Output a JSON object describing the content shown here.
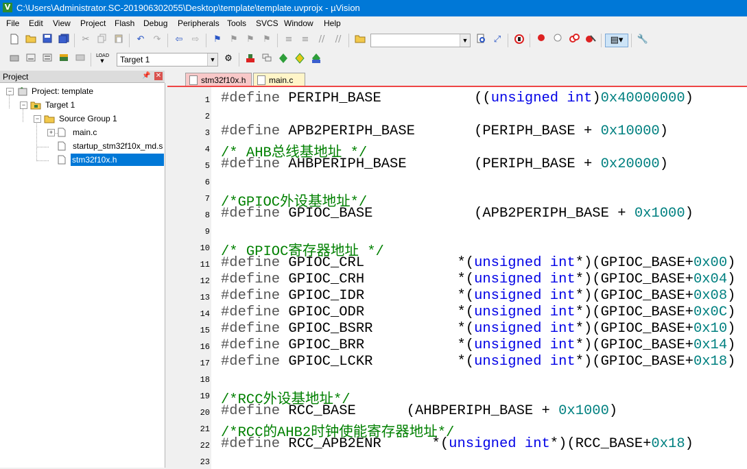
{
  "window": {
    "title": "C:\\Users\\Administrator.SC-201906302055\\Desktop\\template\\template.uvprojx - µVision",
    "app_icon": "V"
  },
  "menu": [
    "File",
    "Edit",
    "View",
    "Project",
    "Flash",
    "Debug",
    "Peripherals",
    "Tools",
    "SVCS",
    "Window",
    "Help"
  ],
  "toolbar2": {
    "target": "Target 1"
  },
  "project_panel": {
    "title": "Project",
    "tree": {
      "project": "Project: template",
      "target": "Target 1",
      "group": "Source Group 1",
      "files": [
        "main.c",
        "startup_stm32f10x_md.s",
        "stm32f10x.h"
      ]
    }
  },
  "tabs": [
    {
      "label": "stm32f10x.h",
      "active": true
    },
    {
      "label": "main.c",
      "active": false
    }
  ],
  "editor": {
    "lines": [
      {
        "n": "1",
        "segs": [
          [
            "kw",
            "#define"
          ],
          [
            "t",
            " PERIPH_BASE           (("
          ],
          [
            "ty",
            "unsigned int"
          ],
          [
            "t",
            ")"
          ],
          [
            "num",
            "0x40000000"
          ],
          [
            "t",
            ")"
          ]
        ]
      },
      {
        "n": "2",
        "segs": []
      },
      {
        "n": "3",
        "segs": [
          [
            "kw",
            "#define"
          ],
          [
            "t",
            " APB2PERIPH_BASE       (PERIPH_BASE + "
          ],
          [
            "num",
            "0x10000"
          ],
          [
            "t",
            ")"
          ]
        ]
      },
      {
        "n": "4",
        "segs": [
          [
            "cm",
            "/* AHB总线基地址 */"
          ]
        ]
      },
      {
        "n": "5",
        "segs": [
          [
            "kw",
            "#define"
          ],
          [
            "t",
            " AHBPERIPH_BASE        (PERIPH_BASE + "
          ],
          [
            "num",
            "0x20000"
          ],
          [
            "t",
            ")"
          ]
        ]
      },
      {
        "n": "6",
        "segs": []
      },
      {
        "n": "7",
        "segs": [
          [
            "cm",
            "/*GPIOC外设基地址*/"
          ]
        ]
      },
      {
        "n": "8",
        "segs": [
          [
            "kw",
            "#define"
          ],
          [
            "t",
            " GPIOC_BASE            (APB2PERIPH_BASE + "
          ],
          [
            "num",
            "0x1000"
          ],
          [
            "t",
            ")"
          ]
        ]
      },
      {
        "n": "9",
        "segs": []
      },
      {
        "n": "10",
        "segs": [
          [
            "cm",
            "/* GPIOC寄存器地址 */"
          ]
        ]
      },
      {
        "n": "11",
        "segs": [
          [
            "kw",
            "#define"
          ],
          [
            "t",
            " GPIOC_CRL           *("
          ],
          [
            "ty",
            "unsigned int"
          ],
          [
            "t",
            "*)(GPIOC_BASE+"
          ],
          [
            "num",
            "0x00"
          ],
          [
            "t",
            ")"
          ]
        ]
      },
      {
        "n": "12",
        "segs": [
          [
            "kw",
            "#define"
          ],
          [
            "t",
            " GPIOC_CRH           *("
          ],
          [
            "ty",
            "unsigned int"
          ],
          [
            "t",
            "*)(GPIOC_BASE+"
          ],
          [
            "num",
            "0x04"
          ],
          [
            "t",
            ")"
          ]
        ]
      },
      {
        "n": "13",
        "segs": [
          [
            "kw",
            "#define"
          ],
          [
            "t",
            " GPIOC_IDR           *("
          ],
          [
            "ty",
            "unsigned int"
          ],
          [
            "t",
            "*)(GPIOC_BASE+"
          ],
          [
            "num",
            "0x08"
          ],
          [
            "t",
            ")"
          ]
        ]
      },
      {
        "n": "14",
        "segs": [
          [
            "kw",
            "#define"
          ],
          [
            "t",
            " GPIOC_ODR           *("
          ],
          [
            "ty",
            "unsigned int"
          ],
          [
            "t",
            "*)(GPIOC_BASE+"
          ],
          [
            "num",
            "0x0C"
          ],
          [
            "t",
            ")"
          ]
        ]
      },
      {
        "n": "15",
        "segs": [
          [
            "kw",
            "#define"
          ],
          [
            "t",
            " GPIOC_BSRR          *("
          ],
          [
            "ty",
            "unsigned int"
          ],
          [
            "t",
            "*)(GPIOC_BASE+"
          ],
          [
            "num",
            "0x10"
          ],
          [
            "t",
            ")"
          ]
        ]
      },
      {
        "n": "16",
        "segs": [
          [
            "kw",
            "#define"
          ],
          [
            "t",
            " GPIOC_BRR           *("
          ],
          [
            "ty",
            "unsigned int"
          ],
          [
            "t",
            "*)(GPIOC_BASE+"
          ],
          [
            "num",
            "0x14"
          ],
          [
            "t",
            ")"
          ]
        ]
      },
      {
        "n": "17",
        "segs": [
          [
            "kw",
            "#define"
          ],
          [
            "t",
            " GPIOC_LCKR          *("
          ],
          [
            "ty",
            "unsigned int"
          ],
          [
            "t",
            "*)(GPIOC_BASE+"
          ],
          [
            "num",
            "0x18"
          ],
          [
            "t",
            ")"
          ]
        ]
      },
      {
        "n": "18",
        "segs": []
      },
      {
        "n": "19",
        "segs": [
          [
            "cm",
            "/*RCC外设基地址*/"
          ]
        ]
      },
      {
        "n": "20",
        "segs": [
          [
            "kw",
            "#define"
          ],
          [
            "t",
            " RCC_BASE      (AHBPERIPH_BASE + "
          ],
          [
            "num",
            "0x1000"
          ],
          [
            "t",
            ")"
          ]
        ]
      },
      {
        "n": "21",
        "segs": [
          [
            "cm",
            "/*RCC的AHB2时钟使能寄存器地址*/"
          ]
        ]
      },
      {
        "n": "22",
        "segs": [
          [
            "kw",
            "#define"
          ],
          [
            "t",
            " RCC_APB2ENR      *("
          ],
          [
            "ty",
            "unsigned int"
          ],
          [
            "t",
            "*)(RCC_BASE+"
          ],
          [
            "num",
            "0x18"
          ],
          [
            "t",
            ")"
          ]
        ]
      },
      {
        "n": "23",
        "segs": []
      }
    ]
  }
}
